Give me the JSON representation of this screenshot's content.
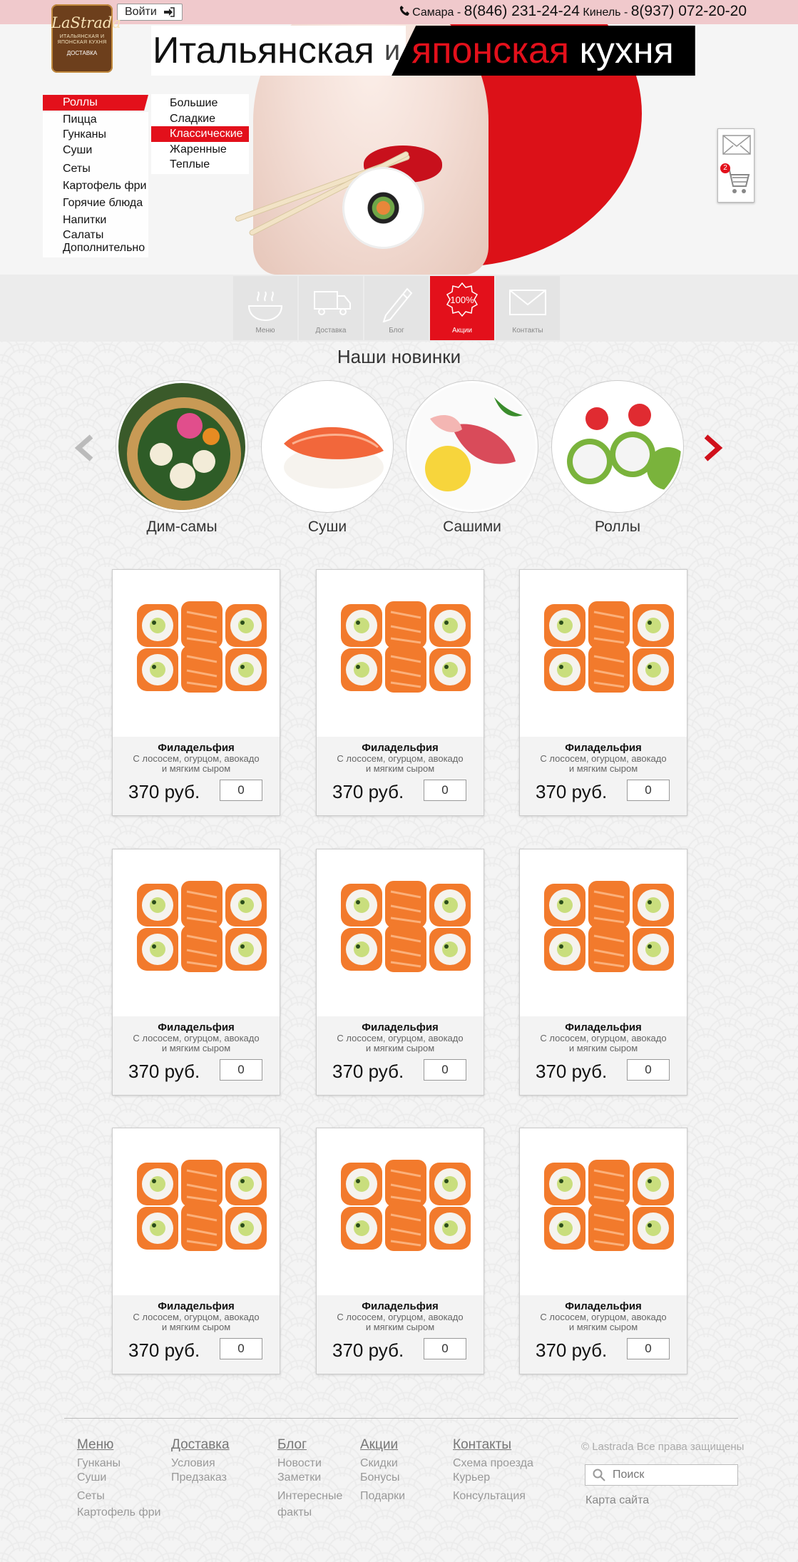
{
  "header": {
    "login_label": "Войти",
    "city1": "Самара - ",
    "phone1": "8(846) 231-24-24",
    "city2": " Кинель - ",
    "phone2": "8(937) 072-20-20"
  },
  "brand": {
    "name": "LaStrada",
    "tagline": "ИТАЛЬЯНСКАЯ И ЯПОНСКАЯ КУХНЯ",
    "delivery": "ДОСТАВКА"
  },
  "banner": {
    "part1": "Итальянская",
    "and": "и",
    "part2": "японская",
    "part3": "кухня"
  },
  "left_menu": {
    "items": [
      "Роллы",
      "Пицца",
      "Гунканы",
      "Суши",
      "Сеты",
      "Картофель фри",
      "Горячие блюда",
      "Напитки",
      "Салаты",
      "Дополнительно"
    ],
    "active": "Роллы"
  },
  "submenu": {
    "items": [
      "Большие",
      "Сладкие",
      "Классические",
      "Жаренные",
      "Теплые"
    ],
    "active": "Классические"
  },
  "side": {
    "cart_count": "2"
  },
  "nav_tiles": [
    {
      "label": "Меню",
      "icon": "bowl-icon"
    },
    {
      "label": "Доставка",
      "icon": "truck-icon"
    },
    {
      "label": "Блог",
      "icon": "pen-icon"
    },
    {
      "label": "Акции",
      "icon": "percent-badge-icon",
      "badge": "100%"
    },
    {
      "label": "Контакты",
      "icon": "envelope-icon"
    }
  ],
  "novelties": {
    "title": "Наши новинки",
    "items": [
      "Дим-самы",
      "Суши",
      "Сашими",
      "Роллы"
    ]
  },
  "products": [
    {
      "name": "Филадельфия",
      "desc1": "С лососем, огурцом, авокадо",
      "desc2": "и мягким сыром",
      "price": "370 руб.",
      "qty": "0"
    },
    {
      "name": "Филадельфия",
      "desc1": "С лососем, огурцом, авокадо",
      "desc2": "и мягким сыром",
      "price": "370 руб.",
      "qty": "0"
    },
    {
      "name": "Филадельфия",
      "desc1": "С лососем, огурцом, авокадо",
      "desc2": "и мягким сыром",
      "price": "370 руб.",
      "qty": "0"
    },
    {
      "name": "Филадельфия",
      "desc1": "С лососем, огурцом, авокадо",
      "desc2": "и мягким сыром",
      "price": "370 руб.",
      "qty": "0"
    },
    {
      "name": "Филадельфия",
      "desc1": "С лососем, огурцом, авокадо",
      "desc2": "и мягким сыром",
      "price": "370 руб.",
      "qty": "0"
    },
    {
      "name": "Филадельфия",
      "desc1": "С лососем, огурцом, авокадо",
      "desc2": "и мягким сыром",
      "price": "370 руб.",
      "qty": "0"
    },
    {
      "name": "Филадельфия",
      "desc1": "С лососем, огурцом, авокадо",
      "desc2": "и мягким сыром",
      "price": "370 руб.",
      "qty": "0"
    },
    {
      "name": "Филадельфия",
      "desc1": "С лососем, огурцом, авокадо",
      "desc2": "и мягким сыром",
      "price": "370 руб.",
      "qty": "0"
    },
    {
      "name": "Филадельфия",
      "desc1": "С лососем, огурцом, авокадо",
      "desc2": "и мягким сыром",
      "price": "370 руб.",
      "qty": "0"
    }
  ],
  "footer": {
    "columns": [
      {
        "heading": "Меню",
        "links": [
          "Гунканы",
          "Суши",
          "Сеты",
          "Картофель фри"
        ]
      },
      {
        "heading": "Доставка",
        "links": [
          "Условия",
          "Предзаказ"
        ]
      },
      {
        "heading": "Блог",
        "links": [
          "Новости",
          "Заметки",
          "Интересные",
          "факты"
        ]
      },
      {
        "heading": "Акции",
        "links": [
          "Скидки",
          "Бонусы",
          "Подарки"
        ]
      },
      {
        "heading": "Контакты",
        "links": [
          "Схема проезда",
          "Курьер",
          "Консультация"
        ]
      }
    ],
    "copyright": "© Lastrada Все права защищены",
    "search_placeholder": "Поиск",
    "sitemap": "Карта сайта"
  },
  "colors": {
    "accent": "#e3101b",
    "topbar": "#f0c9cc"
  }
}
